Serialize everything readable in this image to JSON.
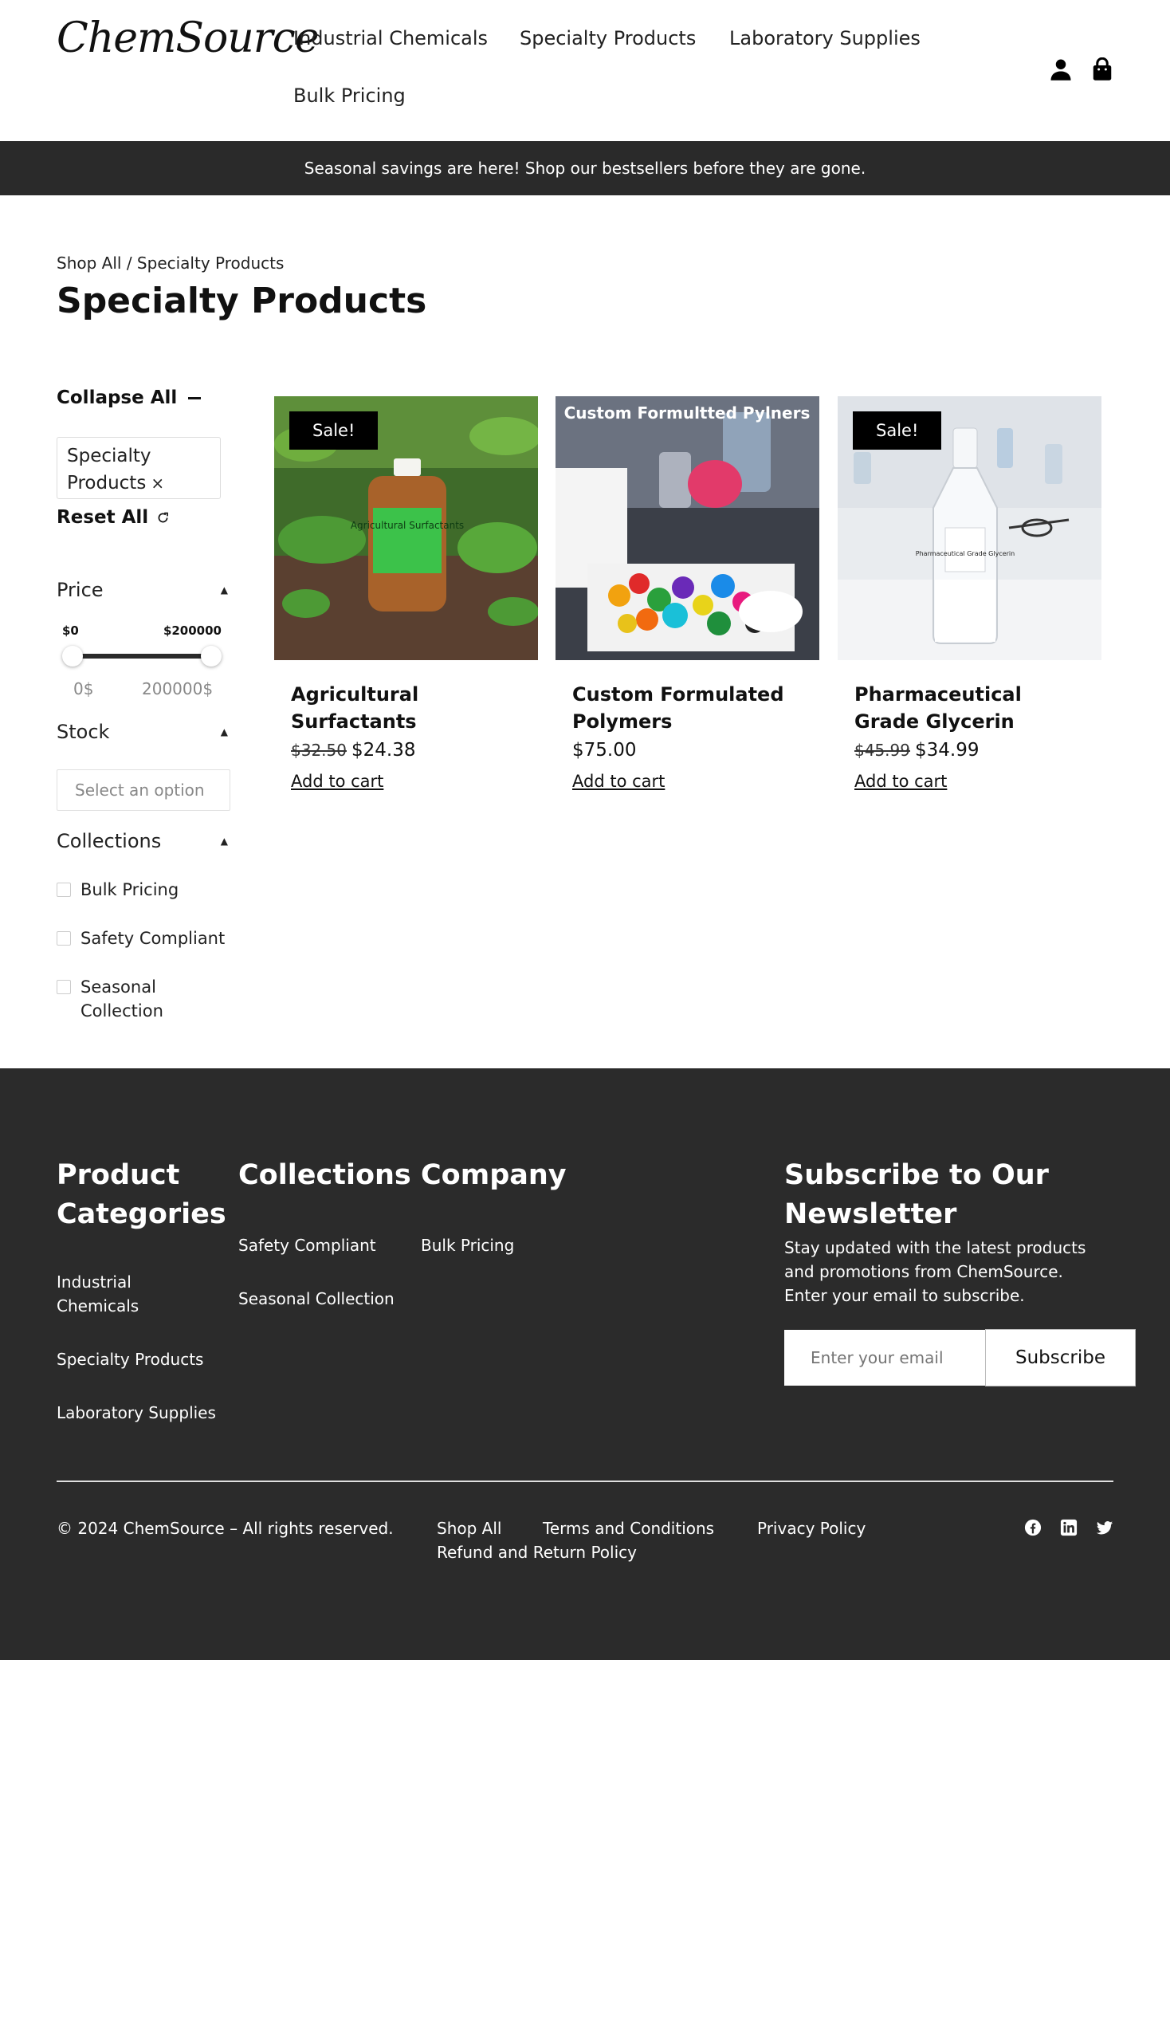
{
  "brand": {
    "logo_text": "ChemSource"
  },
  "nav": {
    "items": [
      {
        "label": "Industrial Chemicals"
      },
      {
        "label": "Specialty Products"
      },
      {
        "label": "Laboratory Supplies"
      },
      {
        "label": "Bulk Pricing"
      }
    ]
  },
  "header_icons": [
    "user-icon",
    "shopping-bag-icon"
  ],
  "promo": {
    "text": "Seasonal savings are here! Shop our bestsellers before they are gone."
  },
  "breadcrumb": {
    "root": "Shop All",
    "separator": " / ",
    "current": "Specialty Products"
  },
  "page": {
    "title": "Specialty Products"
  },
  "filters": {
    "collapse_all": "Collapse All",
    "active_chip": {
      "label": "Specialty Products",
      "remove": "×"
    },
    "reset_all": "Reset All",
    "price": {
      "title": "Price",
      "min_label": "$0",
      "max_label": "$200000",
      "min_value": "0$",
      "max_value": "200000$",
      "range_min": 0,
      "range_max": 200000
    },
    "stock": {
      "title": "Stock",
      "placeholder": "Select an option"
    },
    "collections": {
      "title": "Collections",
      "items": [
        {
          "label": "Bulk Pricing",
          "checked": false
        },
        {
          "label": "Safety Compliant",
          "checked": false
        },
        {
          "label": "Seasonal Collection",
          "checked": false
        }
      ]
    }
  },
  "products": [
    {
      "name": "Agricultural Surfactants",
      "badge": "Sale!",
      "old_price": "$32.50",
      "price": "$24.38",
      "cta": "Add to cart",
      "image_label": "Agricultural Surfactants"
    },
    {
      "name": "Custom Formulated Polymers",
      "badge": "",
      "old_price": "",
      "price": "$75.00",
      "cta": "Add to cart",
      "image_label": "Custom Formultted Pylners"
    },
    {
      "name": "Pharmaceutical Grade Glycerin",
      "badge": "Sale!",
      "old_price": "$45.99",
      "price": "$34.99",
      "cta": "Add to cart",
      "image_label": "Pharmaceutical Grade Glycerin"
    }
  ],
  "footer": {
    "columns": [
      {
        "title": "Product Categories",
        "links": [
          "Industrial Chemicals",
          "Specialty Products",
          "Laboratory Supplies"
        ]
      },
      {
        "title": "Collections",
        "links": [
          "Safety Compliant",
          "Seasonal Collection"
        ]
      },
      {
        "title": "Company",
        "links": [
          "Bulk Pricing"
        ]
      }
    ],
    "newsletter": {
      "title": "Subscribe to Our Newsletter",
      "text": "Stay updated with the latest products and promotions from ChemSource. Enter your email to subscribe.",
      "placeholder": "Enter your email",
      "button": "Subscribe"
    },
    "copyright": "© 2024 ChemSource – All rights reserved.",
    "legal_links": [
      "Shop All",
      "Terms and Conditions",
      "Privacy Policy",
      "Refund and Return Policy"
    ],
    "social": [
      "facebook-icon",
      "linkedin-icon",
      "twitter-icon"
    ]
  },
  "colors": {
    "dark": "#2a2a2a",
    "footer_bg": "#2b2b2b",
    "accent": "#000000",
    "text": "#111111"
  }
}
